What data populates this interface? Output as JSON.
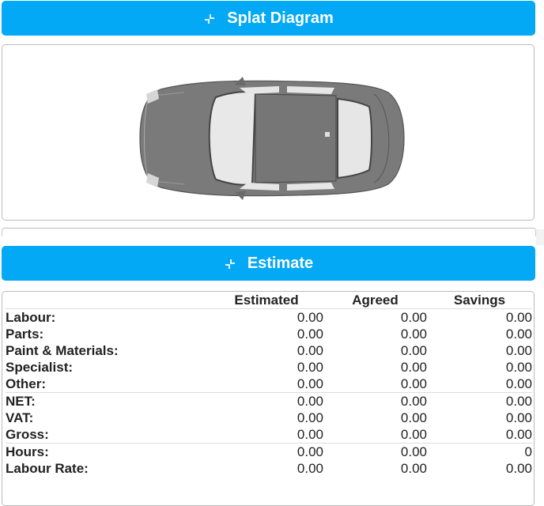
{
  "splat": {
    "title": "Splat Diagram",
    "icon": "collapse-icon",
    "image": "car-top-view"
  },
  "estimate": {
    "title": "Estimate",
    "icon": "collapse-icon",
    "columns": [
      "",
      "Estimated",
      "Agreed",
      "Savings"
    ],
    "rows": [
      {
        "label": "Labour:",
        "estimated": "0.00",
        "agreed": "0.00",
        "savings": "0.00"
      },
      {
        "label": "Parts:",
        "estimated": "0.00",
        "agreed": "0.00",
        "savings": "0.00"
      },
      {
        "label": "Paint & Materials:",
        "estimated": "0.00",
        "agreed": "0.00",
        "savings": "0.00"
      },
      {
        "label": "Specialist:",
        "estimated": "0.00",
        "agreed": "0.00",
        "savings": "0.00"
      },
      {
        "label": "Other:",
        "estimated": "0.00",
        "agreed": "0.00",
        "savings": "0.00"
      },
      {
        "label": "NET:",
        "estimated": "0.00",
        "agreed": "0.00",
        "savings": "0.00"
      },
      {
        "label": "VAT:",
        "estimated": "0.00",
        "agreed": "0.00",
        "savings": "0.00"
      },
      {
        "label": "Gross:",
        "estimated": "0.00",
        "agreed": "0.00",
        "savings": "0.00"
      },
      {
        "label": "Hours:",
        "estimated": "0.00",
        "agreed": "0.00",
        "savings": "0"
      },
      {
        "label": "Labour Rate:",
        "estimated": "0.00",
        "agreed": "0.00",
        "savings": "0.00"
      }
    ]
  }
}
